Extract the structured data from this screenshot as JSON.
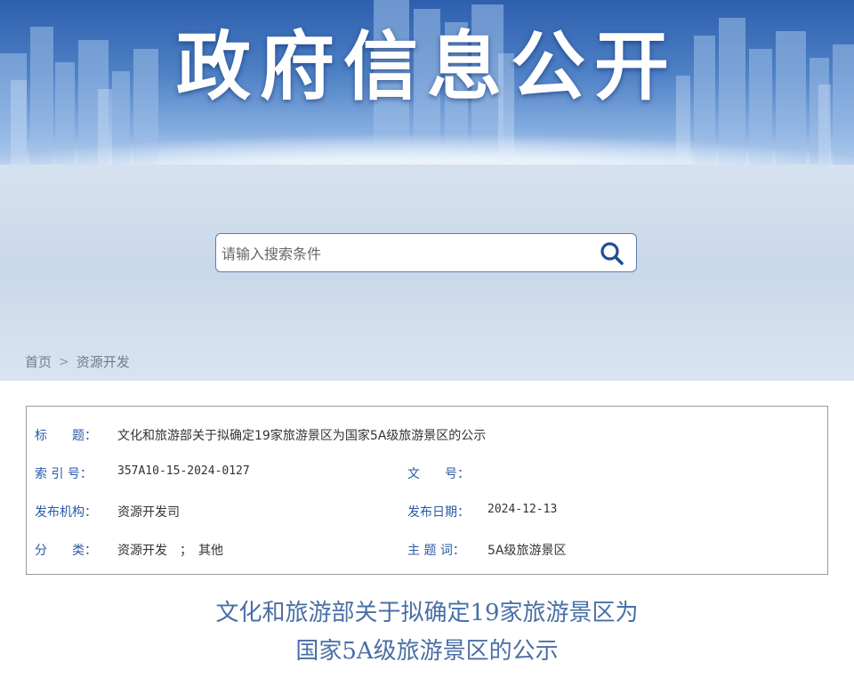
{
  "banner": {
    "title": "政府信息公开"
  },
  "search": {
    "placeholder": "请输入搜索条件",
    "icon": "search-icon"
  },
  "breadcrumb": {
    "home": "首页",
    "separator": ">",
    "current": "资源开发"
  },
  "meta": {
    "title_label": "标　　题：",
    "title_value": "文化和旅游部关于拟确定19家旅游景区为国家5A级旅游景区的公示",
    "index_label": "索 引 号：",
    "index_value": "357A10-15-2024-0127",
    "docno_label": "文　　号：",
    "docno_value": "",
    "publisher_label": "发布机构：",
    "publisher_value": "资源开发司",
    "date_label": "发布日期：",
    "date_value": "2024-12-13",
    "category_label": "分　　类：",
    "category_value": "资源开发　；　其他",
    "subject_label": "主 题 词：",
    "subject_value": "5A级旅游景区"
  },
  "document": {
    "title_line1": "文化和旅游部关于拟确定19家旅游景区为",
    "title_line2": "国家5A级旅游景区的公示"
  },
  "colors": {
    "accent": "#2a5aa6",
    "title": "#4a6fa5",
    "border": "#9a9a9a"
  }
}
